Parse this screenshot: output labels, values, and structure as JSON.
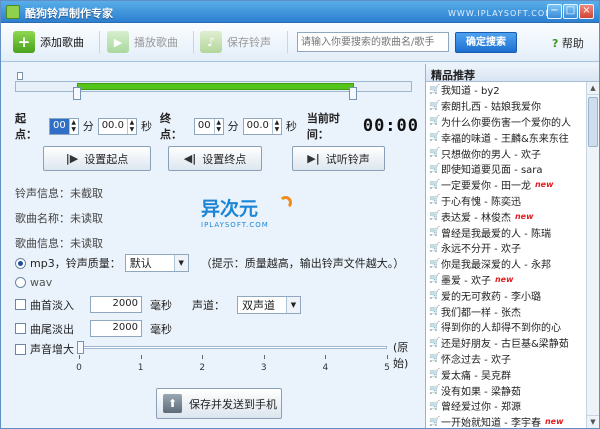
{
  "window": {
    "title": "酷狗铃声制作专家",
    "site": "WWW.IPLAYSOFT.COM",
    "min": "−",
    "max": "□",
    "close": "×"
  },
  "toolbar": {
    "add_label": "添加歌曲",
    "play_label": "播放歌曲",
    "save_label": "保存铃声",
    "search_placeholder": "请输入你要搜索的歌曲名/歌手",
    "search_button": "确定搜索",
    "help_label": "帮助"
  },
  "time": {
    "start_label": "起点：",
    "start_min": "00",
    "min_unit": "分",
    "start_sec": "00.0",
    "sec_unit": "秒",
    "end_label": "终点：",
    "end_min": "00",
    "end_sec": "00.0",
    "current_label": "当前时间：",
    "current_value": "00:00"
  },
  "selection": {
    "start_fraction": 0.155,
    "end_fraction": 0.855
  },
  "actions": {
    "set_start": "设置起点",
    "set_end": "设置终点",
    "preview": "试听铃声"
  },
  "info": {
    "ringtone": "铃声信息：未截取",
    "song_name": "歌曲名称：未读取",
    "song_info": "歌曲信息：未读取"
  },
  "logo": {
    "main": "异次元",
    "sub": "IPLAYSOFT.COM"
  },
  "format": {
    "mp3_label": "mp3，铃声质量：",
    "quality": "默认",
    "hint": "（提示：质量越高，输出铃声文件越大。）",
    "wav_label": "wav"
  },
  "options": {
    "fade_in_label": "曲首淡入",
    "fade_in_value": "2000",
    "ms": "毫秒",
    "fade_out_label": "曲尾淡出",
    "fade_out_value": "2000",
    "channel_label": "声道：",
    "channel_value": "双声道",
    "volume_label": "声音增大",
    "volume_original": "(原始)",
    "volume_value": 0,
    "ticks": [
      "0",
      "1",
      "2",
      "3",
      "4",
      "5"
    ]
  },
  "save_send": "保存并发送到手机",
  "featured": {
    "header": "精品推荐",
    "items": [
      {
        "text": "我知道 - by2",
        "new": ""
      },
      {
        "text": "索朗扎西 - 姑娘我爱你",
        "new": ""
      },
      {
        "text": "为什么你要伤害一个爱你的人",
        "new": ""
      },
      {
        "text": "幸福的味道 - 王麟&东来东往",
        "new": ""
      },
      {
        "text": "只想做你的男人 - 欢子",
        "new": ""
      },
      {
        "text": "即使知道要见面 - sara",
        "new": ""
      },
      {
        "text": "一定要爱你 - 田一龙",
        "new": "new"
      },
      {
        "text": "于心有愧 - 陈奕迅",
        "new": ""
      },
      {
        "text": "表达爱 - 林俊杰",
        "new": "new"
      },
      {
        "text": "曾经是我最爱的人 - 陈瑞",
        "new": ""
      },
      {
        "text": "永远不分开 - 欢子",
        "new": ""
      },
      {
        "text": "你是我最深爱的人 - 永邦",
        "new": ""
      },
      {
        "text": "墨爱 - 欢子",
        "new": "new"
      },
      {
        "text": "爱的无可救药 - 李小璐",
        "new": ""
      },
      {
        "text": "我们都一样 - 张杰",
        "new": ""
      },
      {
        "text": "得到你的人却得不到你的心",
        "new": ""
      },
      {
        "text": "还是好朋友 - 古巨基&梁静茹",
        "new": ""
      },
      {
        "text": "怀念过去 - 欢子",
        "new": ""
      },
      {
        "text": "爱太痛 - 吴克群",
        "new": ""
      },
      {
        "text": "没有如果 - 梁静茹",
        "new": ""
      },
      {
        "text": "曾经爱过你 - 郑源",
        "new": ""
      },
      {
        "text": "一开始就知道 - 李宇春",
        "new": "new"
      }
    ]
  },
  "colors": {
    "accent": "#2c7fd0",
    "selection": "#55c51b",
    "new_badge": "#e02020"
  }
}
